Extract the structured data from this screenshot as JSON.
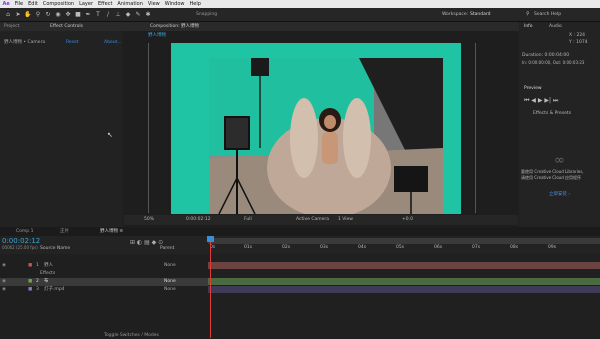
{
  "menu": [
    "File",
    "Edit",
    "Composition",
    "Layer",
    "Effect",
    "Animation",
    "View",
    "Window",
    "Help"
  ],
  "toolbar": {
    "snapping": "Snapping",
    "workspace_label": "Workspace:",
    "workspace_value": "Standard",
    "search": "Search Help"
  },
  "left_panel": {
    "tab_project": "Project",
    "tab_effects": "Effect Controls",
    "layer_label": "野人博物 • Camera",
    "reset": "Reset",
    "about": "About..."
  },
  "comp_panel": {
    "tab": "Composition: 野人博物",
    "breadcrumb": "野人博物"
  },
  "viewer_bar": {
    "zoom": "50%",
    "timecode": "0:00:02:12",
    "quality": "Full",
    "camera": "Active Camera",
    "views": "1 View",
    "offset": "+0.0"
  },
  "right_panel": {
    "tab_info": "Info",
    "tab_audio": "Audio",
    "info_x": "X : 224",
    "info_y": "Y : 1074",
    "duration": "Duration: 0:00:04:00",
    "in_out": "In: 0:00:00:00, Out: 0:00:03:23",
    "preview": "Preview",
    "effects_presets": "Effects & Presets",
    "cc_text_1": "要使用 Creative Cloud Libraries,",
    "cc_text_2": "请使用 Creative Cloud 应用程序",
    "cc_link": "立即安装 ›"
  },
  "tabs": [
    "Comp 1",
    "正片",
    "野人博物 ≡"
  ],
  "timeline": {
    "timecode": "0:00:02:12",
    "fps": "00062 (25.00 fps)",
    "columns": {
      "source": "Source Name",
      "parent": "Parent"
    },
    "ruler": [
      "0s",
      "01s",
      "02s",
      "03s",
      "04s",
      "05s",
      "06s",
      "07s",
      "08s",
      "09s"
    ],
    "toggle": "Toggle Switches / Modes"
  },
  "layers": [
    {
      "num": "1",
      "name": "野人",
      "parent": "None"
    },
    {
      "num": "",
      "name": "Effects",
      "parent": ""
    },
    {
      "num": "2",
      "name": "布",
      "parent": "None"
    },
    {
      "num": "3",
      "name": "灯子.mp4",
      "parent": "None"
    }
  ]
}
